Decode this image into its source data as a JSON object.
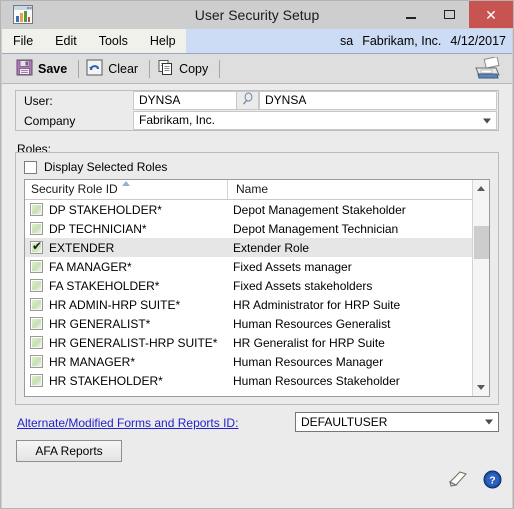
{
  "window": {
    "title": "User Security Setup",
    "icon": "gp-window-icon",
    "caption_buttons": [
      {
        "name": "minimize",
        "glyph": "minimize-icon"
      },
      {
        "name": "maximize",
        "glyph": "maximize-icon"
      },
      {
        "name": "close",
        "glyph": "close-icon",
        "color": "#c75450"
      }
    ]
  },
  "menubar": {
    "items": [
      "File",
      "Edit",
      "Tools",
      "Help"
    ],
    "status": {
      "user": "sa",
      "company": "Fabrikam, Inc.",
      "date": "4/12/2017"
    },
    "background": "#ccdcf5"
  },
  "toolbar": {
    "buttons": [
      {
        "label": "Save",
        "icon": "save-floppy-icon"
      },
      {
        "label": "Clear",
        "icon": "undo-arrow-icon"
      },
      {
        "label": "Copy",
        "icon": "copy-pages-icon"
      }
    ],
    "print_icon": "printer-icon"
  },
  "fields": {
    "user": {
      "label": "User:",
      "value": "DYNSA",
      "lookup_icon": "lookup-magnifier-icon",
      "secondary_value": "DYNSA"
    },
    "company": {
      "label": "Company",
      "value": "Fabrikam, Inc.",
      "dropdown_icon": "chevron-down-icon"
    }
  },
  "roles": {
    "group_label": "Roles:",
    "display_selected": {
      "label": "Display Selected Roles",
      "checked": false
    },
    "columns": [
      "Security Role ID",
      "Name"
    ],
    "sort_column": "Security Role ID",
    "sort_icon": "sort-ascending-icon",
    "rows": [
      {
        "checked": false,
        "id": "DP STAKEHOLDER*",
        "name": "Depot Management Stakeholder",
        "selected": false
      },
      {
        "checked": false,
        "id": "DP TECHNICIAN*",
        "name": "Depot Management Technician",
        "selected": false
      },
      {
        "checked": true,
        "id": "EXTENDER",
        "name": "Extender Role",
        "selected": true
      },
      {
        "checked": false,
        "id": "FA MANAGER*",
        "name": "Fixed Assets manager",
        "selected": false
      },
      {
        "checked": false,
        "id": "FA STAKEHOLDER*",
        "name": "Fixed Assets stakeholders",
        "selected": false
      },
      {
        "checked": false,
        "id": "HR ADMIN-HRP SUITE*",
        "name": "HR Administrator for HRP Suite",
        "selected": false
      },
      {
        "checked": false,
        "id": "HR GENERALIST*",
        "name": "Human Resources Generalist",
        "selected": false
      },
      {
        "checked": false,
        "id": "HR GENERALIST-HRP SUITE*",
        "name": "HR Generalist for HRP Suite",
        "selected": false
      },
      {
        "checked": false,
        "id": "HR MANAGER*",
        "name": "Human Resources Manager",
        "selected": false
      },
      {
        "checked": false,
        "id": "HR STAKEHOLDER*",
        "name": "Human Resources Stakeholder",
        "selected": false
      }
    ],
    "scrollbar": {
      "up_icon": "chevron-up-icon",
      "down_icon": "chevron-down-icon"
    }
  },
  "bottom": {
    "alternate_link": "Alternate/Modified Forms and Reports ID:",
    "alternate_value": "DEFAULTUSER",
    "afa_button": "AFA Reports",
    "note_icon": "note-icon",
    "help_icon": "help-icon"
  }
}
